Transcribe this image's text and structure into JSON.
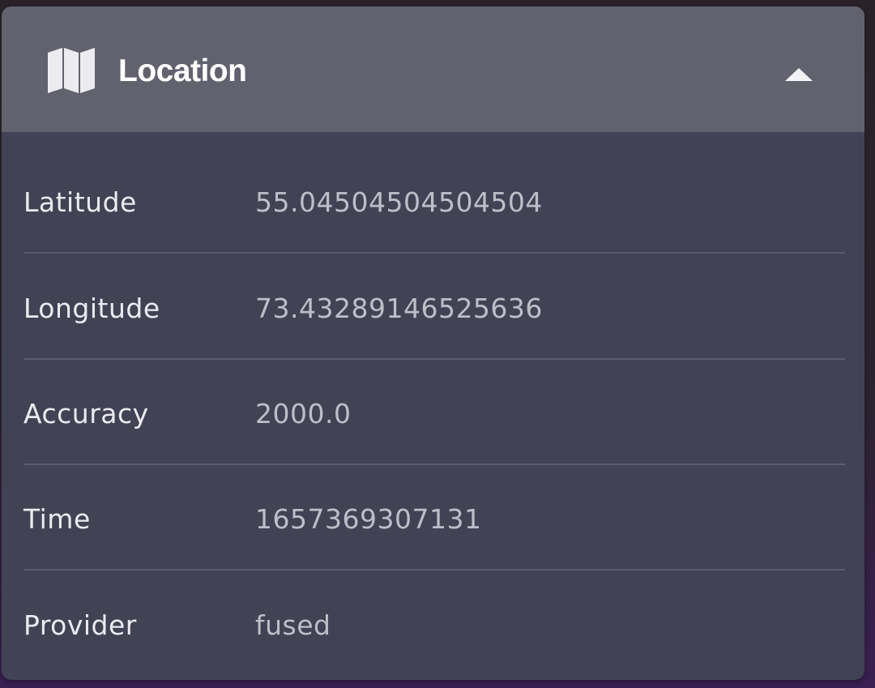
{
  "panel": {
    "title": "Location",
    "icon": "map-icon",
    "collapse_icon": "chevron-up-icon",
    "colors": {
      "header_bg": "#62626f",
      "body_bg": "#414355",
      "label": "#eceaf0",
      "value": "#bfbdc8"
    }
  },
  "rows": [
    {
      "label": "Latitude",
      "value": "55.04504504504504"
    },
    {
      "label": "Longitude",
      "value": "73.43289146525636"
    },
    {
      "label": "Accuracy",
      "value": "2000.0"
    },
    {
      "label": "Time",
      "value": "1657369307131"
    },
    {
      "label": "Provider",
      "value": "fused"
    }
  ]
}
